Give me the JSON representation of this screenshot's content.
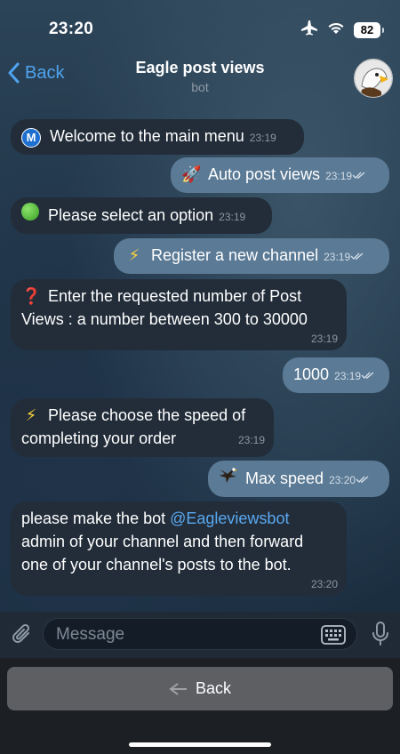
{
  "status": {
    "time": "23:20",
    "battery": "82"
  },
  "header": {
    "back_label": "Back",
    "title": "Eagle post views",
    "subtitle": "bot"
  },
  "messages": [
    {
      "text": "Welcome to the main menu",
      "time": "23:19"
    },
    {
      "text": "Auto post views",
      "time": "23:19"
    },
    {
      "text": "Please select an option",
      "time": "23:19"
    },
    {
      "text": "Register a new channel",
      "time": "23:19"
    },
    {
      "text_line1": "Enter the requested number of Post",
      "text_line2": "Views : a number between 300 to 30000",
      "time": "23:19"
    },
    {
      "text": "1000",
      "time": "23:19"
    },
    {
      "text_line1": "Please choose the speed of",
      "text_line2": "completing your order",
      "time": "23:19"
    },
    {
      "text": "Max speed",
      "time": "23:20"
    },
    {
      "line1_prefix": "please make the bot ",
      "mention": "@Eagleviewsbot",
      "line2": "admin of your channel and then forward",
      "line3": "one of your channel's posts to the bot.",
      "time": "23:20"
    }
  ],
  "input": {
    "placeholder": "Message"
  },
  "keyboard": {
    "back_label": "Back"
  },
  "icons": {
    "status": [
      "airplane-icon",
      "wifi-icon",
      "battery-icon"
    ],
    "header": [
      "chevron-left-icon",
      "eagle-avatar"
    ],
    "messages": [
      "m-badge-icon",
      "rocket-icon",
      "green-circle-icon",
      "lightning-icon",
      "question-mark-icon",
      "eagle-icon",
      "read-check-icon"
    ],
    "input": [
      "paperclip-icon",
      "keyboard-icon",
      "microphone-icon"
    ]
  },
  "colors": {
    "accent": "#4fa3ef",
    "incoming_bubble": "#222d39",
    "outgoing_bubble": "#5b7a95",
    "link": "#5aa8f0"
  }
}
